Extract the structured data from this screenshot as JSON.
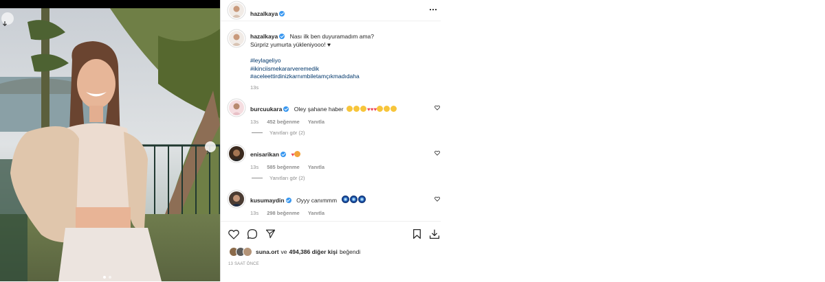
{
  "post": {
    "username": "hazalkaya",
    "caption_line1": "Nası ilk ben duyuramadım ama?",
    "caption_line2": "Sürpriz yumurta yükleniyooo! ♥",
    "hashtags": [
      "#leylageliyo",
      "#ikinciismekararveremedik",
      "#aceleettirdinizkarnımbiletamçıkmadıdaha"
    ],
    "caption_time": "13s"
  },
  "comments": [
    {
      "username": "burcuukara",
      "text": "Oley şahane haber",
      "time": "13s",
      "likes": "452 beğenme",
      "reply": "Yanıtla",
      "replies_label": "Yanıtları gör (2)"
    },
    {
      "username": "enisarikan",
      "text": "",
      "time": "13s",
      "likes": "585 beğenme",
      "reply": "Yanıtla",
      "replies_label": "Yanıtları gör (2)"
    },
    {
      "username": "kusumaydin",
      "text": "Oyyy canımmm",
      "time": "13s",
      "likes": "298 beğenme",
      "reply": "Yanıtla"
    }
  ],
  "likes": {
    "first_user": "suna.ort",
    "connector": "ve",
    "others": "494,386 diğer kişi",
    "suffix": "beğendi"
  },
  "post_time_caps": "13 SAAT ÖNCE",
  "icons": {
    "more": "more-options-icon",
    "like": "heart-icon",
    "comment": "comment-icon",
    "share": "share-icon",
    "save": "bookmark-icon",
    "download": "download-icon"
  },
  "colors": {
    "link": "#00376b",
    "verified": "#3897f0",
    "muted": "#8e8e8e",
    "heart_red": "#ed4956"
  }
}
